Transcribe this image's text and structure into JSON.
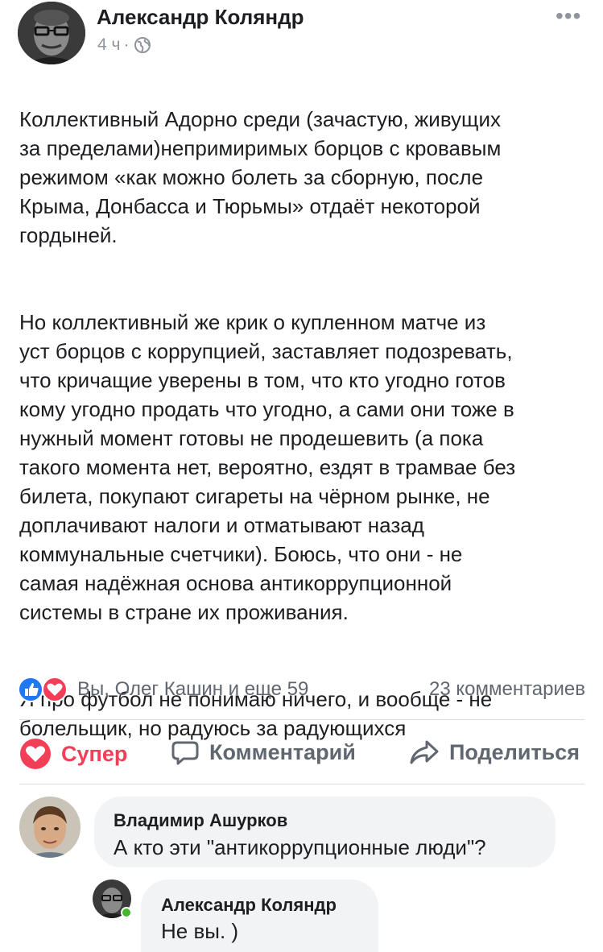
{
  "post": {
    "author": "Александр Коляндр",
    "time": "4 ч",
    "separator": "·",
    "paragraphs": [
      "Коллективный Адорно среди (зачастую, живущих\nза пределами)непримиримых борцов с кровавым\nрежимом «как можно болеть за сборную, после\nКрыма, Донбасса и Тюрьмы» отдаёт некоторой\nгордыней.",
      "Но коллективный же крик о купленном матче из\nуст борцов с коррупцией, заставляет подозревать,\nчто кричащие уверены в том, что кто угодно готов\nкому угодно продать что угодно, а сами они тоже в\nнужный момент готовы не продешевить (а пока\nтакого момента нет, вероятно, ездят в трамвае без\nбилета, покупают сигареты на чёрном рынке, не\nдоплачивают налоги  и отматывают назад\nкоммунальные счетчики). Боюсь, что они - не\nсамая надёжная основа  антикоррупционной\nсистемы в стране их проживания.",
      "Я про футбол не понимаю ничего, и вообще - не\nболельщик, но радуюсь за радующихся"
    ]
  },
  "reactions": {
    "names": "Вы, Олег Кашин и еще 59",
    "comments_count": "23 комментариев",
    "like_color": "#2078f4",
    "love_color": "#f33e58"
  },
  "actions": {
    "super": "Супер",
    "comment": "Комментарий",
    "share": "Поделиться"
  },
  "comments": [
    {
      "author": "Владимир Ашурков",
      "text": "А кто эти \"антикоррупционные люди\"?"
    },
    {
      "author": "Александр Коляндр",
      "text": "Не вы. )"
    }
  ]
}
